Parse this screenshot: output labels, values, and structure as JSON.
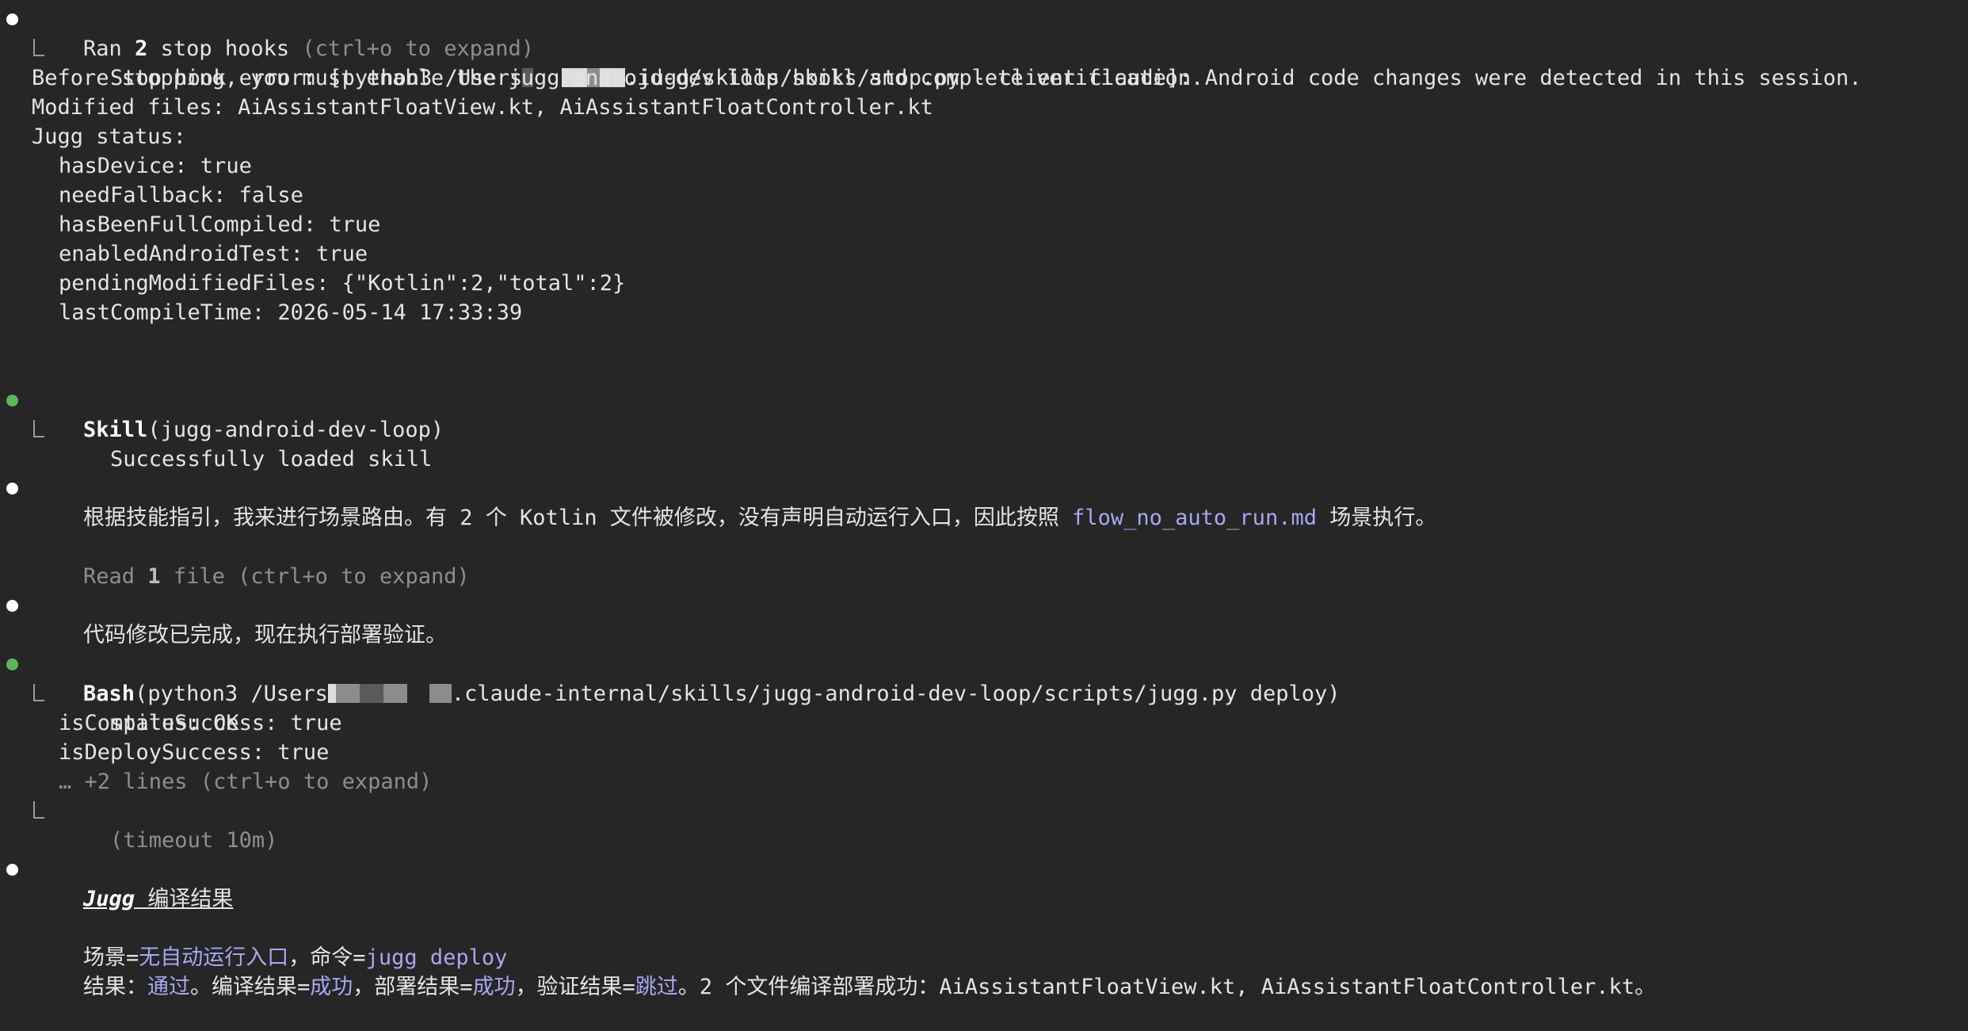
{
  "stop_hooks": {
    "title_prefix": "Ran ",
    "title_count": "2",
    "title_suffix": " stop hooks ",
    "expand_hint": "(ctrl+o to expand)",
    "error_prefix": "Stop hook error: [python3 /Users",
    "error_suffix": ".jugg/skills/hooks/stop.py --client claude]: Android code changes were detected in this session.",
    "line2": "Before stopping, you must enable the jugg-android-dev-loop skill and complete verification.",
    "line3": "Modified files: AiAssistantFloatView.kt, AiAssistantFloatController.kt",
    "line4": "Jugg status:",
    "status_lines": [
      "hasDevice: true",
      "needFallback: false",
      "hasBeenFullCompiled: true",
      "enabledAndroidTest: true",
      "pendingModifiedFiles: {\"Kotlin\":2,\"total\":2}",
      "lastCompileTime: 2026-05-14 17:33:39"
    ]
  },
  "skill": {
    "name": "Skill",
    "arg": "(jugg-android-dev-loop)",
    "result": "Successfully loaded skill"
  },
  "routing": {
    "text_before": "根据技能指引，我来进行场景路由。有 2 个 Kotlin 文件被修改，没有声明自动运行入口，因此按照 ",
    "file": "flow_no_auto_run.md",
    "text_after": " 场景执行。"
  },
  "read": {
    "prefix": "Read ",
    "count": "1",
    "suffix": " file ",
    "hint": "(ctrl+o to expand)"
  },
  "done": {
    "text": "代码修改已完成，现在执行部署验证。"
  },
  "bash": {
    "name": "Bash",
    "arg_prefix": "(python3 /Users",
    "arg_suffix": ".claude-internal/skills/jugg-android-dev-loop/scripts/jugg.py deploy)",
    "output": [
      "status: OK",
      "isCompileSuccess: true",
      "isDeploySuccess: true"
    ],
    "more_lines": "… +2 lines (ctrl+o to expand)",
    "timeout": "(timeout 10m)"
  },
  "result_section": {
    "title_bold": "Jugg",
    "title_rest": " 编译结果",
    "scene_label": "场景=",
    "scene_value": "无自动运行入口",
    "command_label": "，命令=",
    "command_value": "jugg deploy",
    "result_label": "结果：",
    "result_value": "通过",
    "compile_label": "。编译结果=",
    "compile_value": "成功",
    "deploy_label": "，部署结果=",
    "deploy_value": "成功",
    "verify_label": "，验证结果=",
    "verify_value": "跳过",
    "summary": "。2 个文件编译部署成功：AiAssistantFloatView.kt, AiAssistantFloatController.kt。"
  },
  "colors": {
    "background": "#262626",
    "text": "#e4e4e4",
    "dim": "#8e8e8e",
    "accent_purple": "#a9a6f2",
    "bullet_green": "#5fb65a",
    "bullet_white": "#ffffff"
  }
}
